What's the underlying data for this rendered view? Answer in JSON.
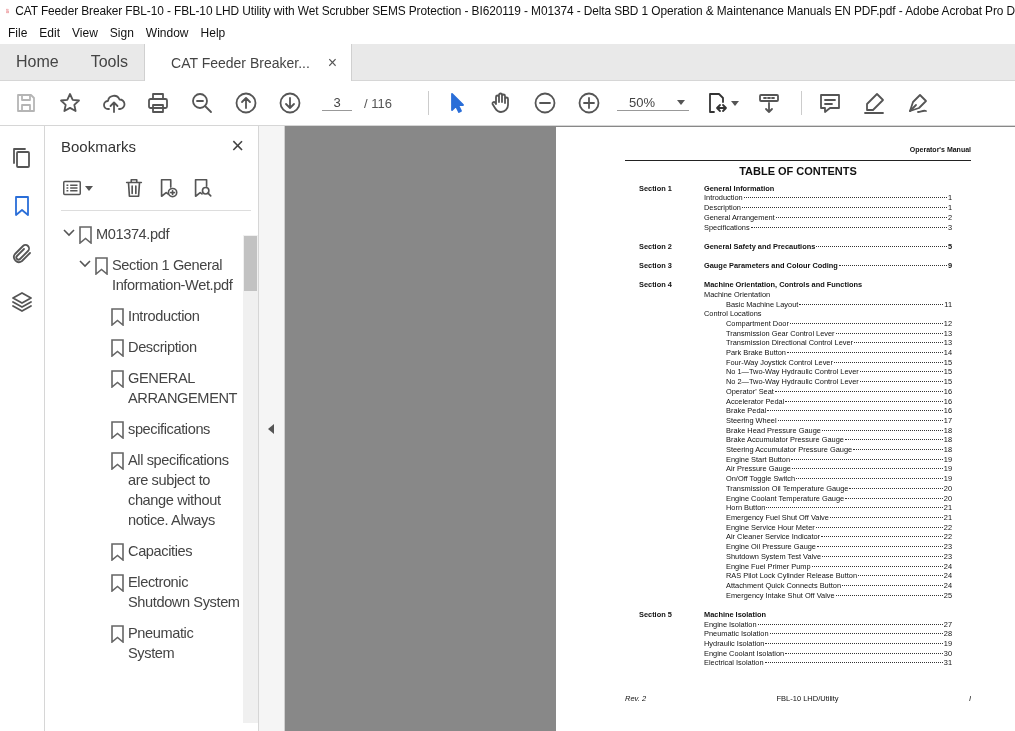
{
  "window": {
    "title": "CAT Feeder Breaker FBL-10 - FBL-10 LHD Utility with Wet Scrubber SEMS Protection - BI620119 - M01374 - Delta SBD 1 Operation & Maintenance Manuals EN PDF.pdf - Adobe Acrobat Pro D"
  },
  "menu": [
    "File",
    "Edit",
    "View",
    "Sign",
    "Window",
    "Help"
  ],
  "tabs": [
    {
      "label": "Home",
      "selected": false,
      "kind": "plain"
    },
    {
      "label": "Tools",
      "selected": false,
      "kind": "plain"
    },
    {
      "label": "CAT Feeder Breaker...",
      "selected": true,
      "kind": "document",
      "close": "×"
    }
  ],
  "toolbar": {
    "tools": [
      {
        "kind": "save",
        "disabled": true,
        "selected": false
      },
      {
        "kind": "star",
        "disabled": false,
        "selected": false
      },
      {
        "kind": "upload",
        "disabled": false,
        "selected": false
      },
      {
        "kind": "print",
        "disabled": false,
        "selected": false
      },
      {
        "kind": "find",
        "disabled": false,
        "selected": false
      },
      {
        "kind": "page-up",
        "disabled": false,
        "selected": false
      },
      {
        "kind": "page-down",
        "disabled": false,
        "selected": false
      },
      {
        "kind": "page-field",
        "disabled": false,
        "selected": false
      },
      {
        "kind": "pointer",
        "disabled": false,
        "selected": true
      },
      {
        "kind": "hand",
        "disabled": false,
        "selected": false
      },
      {
        "kind": "zoom-out",
        "disabled": false,
        "selected": false
      },
      {
        "kind": "zoom-in",
        "disabled": false,
        "selected": false
      },
      {
        "kind": "zoom-field",
        "disabled": false,
        "selected": false
      },
      {
        "kind": "fit",
        "disabled": false,
        "selected": false
      },
      {
        "kind": "scroll",
        "disabled": false,
        "selected": false
      },
      {
        "kind": "comment",
        "disabled": false,
        "selected": false
      },
      {
        "kind": "highlight",
        "disabled": false,
        "selected": false
      },
      {
        "kind": "sign",
        "disabled": false,
        "selected": false
      }
    ],
    "page": "3",
    "page_count": "/ 116",
    "zoom": "50%"
  },
  "rail": [
    {
      "kind": "pages",
      "selected": false
    },
    {
      "kind": "bookmarks",
      "selected": true
    },
    {
      "kind": "attachments",
      "selected": false
    },
    {
      "kind": "layers",
      "selected": false
    }
  ],
  "bookmarks": {
    "title": "Bookmarks",
    "close": "×",
    "items": [
      {
        "label": "M01374.pdf",
        "expanded": true,
        "children": [
          {
            "label": "Section 1 General Information-Wet.pdf",
            "expanded": true,
            "children": [
              {
                "label": "Introduction"
              },
              {
                "label": "Description"
              },
              {
                "label": "GENERAL ARRANGEMENT"
              },
              {
                "label": "specifications"
              },
              {
                "label": "All specifications are subject to change without notice. Always"
              },
              {
                "label": "Capacities"
              },
              {
                "label": "Electronic Shutdown System"
              },
              {
                "label": "Pneumatic System"
              }
            ]
          }
        ]
      }
    ]
  },
  "document": {
    "header": "Operator's Manual",
    "title": "TABLE OF CONTENTS",
    "sections": [
      {
        "label": "Section 1",
        "title": "General Information",
        "entries": [
          {
            "text": "Introduction",
            "page": "1"
          },
          {
            "text": "Description",
            "page": "1"
          },
          {
            "text": "General Arrangement",
            "page": "2"
          },
          {
            "text": "Specifications",
            "page": "3"
          }
        ]
      },
      {
        "label": "Section 2",
        "title": "General Safety and Precautions",
        "page": "5"
      },
      {
        "label": "Section 3",
        "title": "Gauge Parameters and Colour Coding",
        "page": "9"
      },
      {
        "label": "Section 4",
        "title": "Machine Orientation, Controls and Functions",
        "entries": [
          {
            "text": "Machine Orientation",
            "children": [
              {
                "text": "Basic Machine Layout",
                "page": "11"
              }
            ]
          },
          {
            "text": "Control Locations",
            "children": [
              {
                "text": "Compartment Door",
                "page": "12"
              },
              {
                "text": "Transmission Gear Control Lever",
                "page": "13"
              },
              {
                "text": "Transmission Directional Control Lever",
                "page": "13"
              },
              {
                "text": "Park Brake Button",
                "page": "14"
              },
              {
                "text": "Four-Way Joystick Control Lever",
                "page": "15"
              },
              {
                "text": "No 1—Two-Way Hydraulic Control Lever",
                "page": "15"
              },
              {
                "text": "No 2—Two-Way Hydraulic Control Lever",
                "page": "15"
              },
              {
                "text": "Operator' Seat",
                "page": "16"
              },
              {
                "text": "Accelerator Pedal",
                "page": "16"
              },
              {
                "text": "Brake Pedal",
                "page": "16"
              },
              {
                "text": "Steering Wheel",
                "page": "17"
              },
              {
                "text": "Brake Head Pressure Gauge",
                "page": "18"
              },
              {
                "text": "Brake Accumulator Pressure Gauge",
                "page": "18"
              },
              {
                "text": "Steering Accumulator Pressure Gauge",
                "page": "18"
              },
              {
                "text": "Engine Start Button",
                "page": "19"
              },
              {
                "text": "Air Pressure Gauge",
                "page": "19"
              },
              {
                "text": "On/Off Toggle Switch",
                "page": "19"
              },
              {
                "text": "Transmission Oil Temperature Gauge",
                "page": "20"
              },
              {
                "text": "Engine Coolant Temperature Gauge",
                "page": "20"
              },
              {
                "text": "Horn Button",
                "page": "21"
              },
              {
                "text": "Emergency Fuel Shut Off Valve",
                "page": "21"
              },
              {
                "text": "Engine Service Hour Meter",
                "page": "22"
              },
              {
                "text": "Air Cleaner Service Indicator",
                "page": "22"
              },
              {
                "text": "Engine Oil Pressure Gauge",
                "page": "23"
              },
              {
                "text": "Shutdown System Test Valve",
                "page": "23"
              },
              {
                "text": "Engine Fuel Primer Pump",
                "page": "24"
              },
              {
                "text": "RAS Pilot Lock Cylinder Release Button",
                "page": "24"
              },
              {
                "text": "Attachment Quick Connects Button",
                "page": "24"
              },
              {
                "text": "Emergency Intake Shut Off Valve",
                "page": "25"
              }
            ]
          }
        ]
      },
      {
        "label": "Section 5",
        "title": "Machine Isolation",
        "entries": [
          {
            "text": "Engine Isolation",
            "page": "27"
          },
          {
            "text": "Pneumatic Isolation",
            "page": "28"
          },
          {
            "text": "Hydraulic Isolation",
            "page": "19"
          },
          {
            "text": "Engine Coolant Isolation",
            "page": "30"
          },
          {
            "text": "Electrical Isolation",
            "page": "31"
          }
        ]
      }
    ],
    "footer": {
      "left": "Rev. 2",
      "center": "FBL-10 LHD/Utility",
      "right": "I"
    }
  }
}
